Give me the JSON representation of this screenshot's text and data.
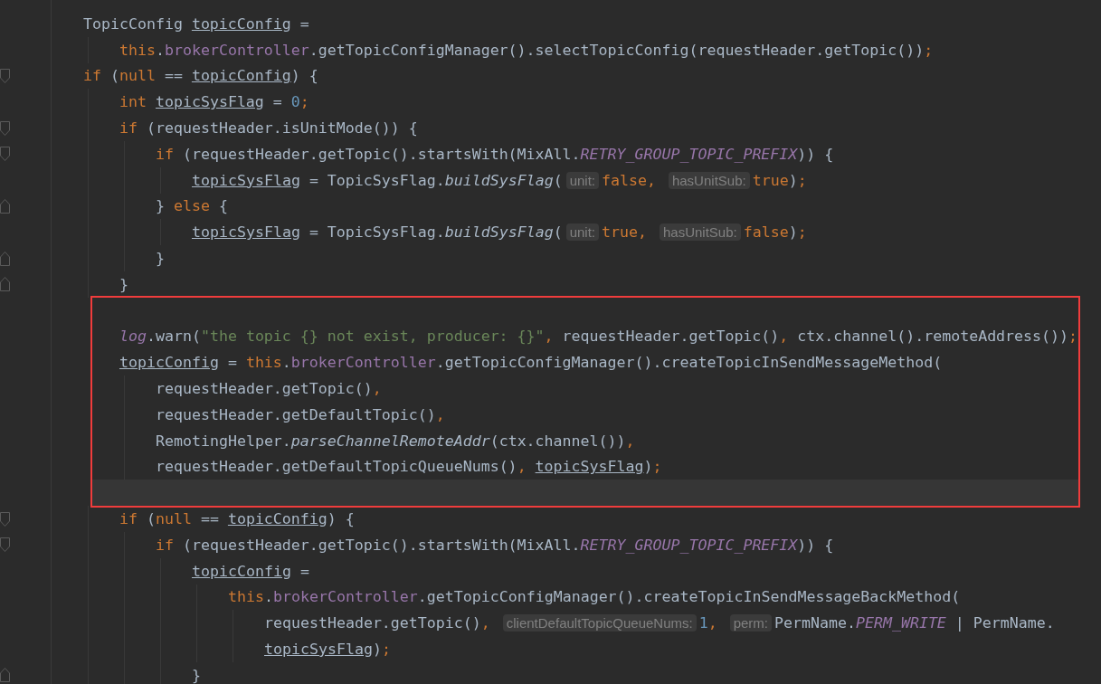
{
  "lines": [
    {
      "tokens": [
        {
          "kind": "plain",
          "text": "TopicConfig "
        },
        {
          "kind": "local",
          "text": "topicConfig"
        },
        {
          "kind": "plain",
          "text": " ="
        }
      ],
      "children": [
        {
          "tokens": [
            {
              "kind": "keyword",
              "text": "this"
            },
            {
              "kind": "plain",
              "text": "."
            },
            {
              "kind": "field",
              "text": "brokerController"
            },
            {
              "kind": "plain",
              "text": ".getTopicConfigManager().selectTopicConfig(requestHeader.getTopic())"
            },
            {
              "kind": "keyword",
              "text": ";"
            }
          ]
        }
      ]
    },
    {
      "fold_start": true,
      "tokens": [
        {
          "kind": "keyword",
          "text": "if"
        },
        {
          "kind": "plain",
          "text": " ("
        },
        {
          "kind": "keyword",
          "text": "null"
        },
        {
          "kind": "plain",
          "text": " == "
        },
        {
          "kind": "local",
          "text": "topicConfig"
        },
        {
          "kind": "plain",
          "text": ") {"
        }
      ],
      "children": [
        {
          "kind": "line",
          "tokens": [
            {
              "kind": "keyword",
              "text": "int "
            },
            {
              "kind": "local",
              "text": "topicSysFlag"
            },
            {
              "kind": "plain",
              "text": " = "
            },
            {
              "kind": "number",
              "text": "0"
            },
            {
              "kind": "keyword",
              "text": ";"
            }
          ]
        },
        {
          "kind": "line",
          "fold_start": true,
          "tokens": [
            {
              "kind": "keyword",
              "text": "if"
            },
            {
              "kind": "plain",
              "text": " (requestHeader.isUnitMode()) {"
            }
          ],
          "children": [
            {
              "fold_start": true,
              "tokens": [
                {
                  "kind": "keyword",
                  "text": "if"
                },
                {
                  "kind": "plain",
                  "text": " (requestHeader.getTopic().startsWith(MixAll."
                },
                {
                  "kind": "constant",
                  "text": "RETRY_GROUP_TOPIC_PREFIX"
                },
                {
                  "kind": "plain",
                  "text": ")) {"
                }
              ],
              "children": [
                {
                  "tokens": [
                    {
                      "kind": "local",
                      "text": "topicSysFlag"
                    },
                    {
                      "kind": "plain",
                      "text": " = TopicSysFlag."
                    },
                    {
                      "kind": "method",
                      "text": "buildSysFlag"
                    },
                    {
                      "kind": "plain",
                      "text": "("
                    },
                    {
                      "kind": "hint",
                      "text": "unit:"
                    },
                    {
                      "kind": "keyword",
                      "text": "false, "
                    },
                    {
                      "kind": "hint",
                      "text": "hasUnitSub:"
                    },
                    {
                      "kind": "keyword",
                      "text": "true"
                    },
                    {
                      "kind": "plain",
                      "text": ")"
                    },
                    {
                      "kind": "keyword",
                      "text": ";"
                    }
                  ]
                }
              ]
            },
            {
              "fold_end": true,
              "tokens": [
                {
                  "kind": "plain",
                  "text": "} "
                },
                {
                  "kind": "keyword",
                  "text": "else"
                },
                {
                  "kind": "plain",
                  "text": " {"
                }
              ],
              "children": [
                {
                  "tokens": [
                    {
                      "kind": "local",
                      "text": "topicSysFlag"
                    },
                    {
                      "kind": "plain",
                      "text": " = TopicSysFlag."
                    },
                    {
                      "kind": "method",
                      "text": "buildSysFlag"
                    },
                    {
                      "kind": "plain",
                      "text": "("
                    },
                    {
                      "kind": "hint",
                      "text": "unit:"
                    },
                    {
                      "kind": "keyword",
                      "text": "true, "
                    },
                    {
                      "kind": "hint",
                      "text": "hasUnitSub:"
                    },
                    {
                      "kind": "keyword",
                      "text": "false"
                    },
                    {
                      "kind": "plain",
                      "text": ")"
                    },
                    {
                      "kind": "keyword",
                      "text": ";"
                    }
                  ]
                }
              ]
            },
            {
              "fold_end": true,
              "tokens": [
                {
                  "kind": "plain",
                  "text": "}"
                }
              ]
            }
          ]
        },
        {
          "kind": "line",
          "fold_end": true,
          "tokens": [
            {
              "kind": "plain",
              "text": "}"
            }
          ]
        },
        {
          "kind": "highlight_box",
          "children": [
            {
              "kind": "line"
            },
            {
              "kind": "line",
              "tokens": [
                {
                  "kind": "static",
                  "text": "log"
                },
                {
                  "kind": "plain",
                  "text": ".warn("
                },
                {
                  "kind": "string",
                  "text": "\"the topic {} not exist, producer: {}\""
                },
                {
                  "kind": "keyword",
                  "text": ","
                },
                {
                  "kind": "plain",
                  "text": " requestHeader.getTopic()"
                },
                {
                  "kind": "keyword",
                  "text": ","
                },
                {
                  "kind": "plain",
                  "text": " ctx.channel().remoteAddress())"
                },
                {
                  "kind": "keyword",
                  "text": ";"
                }
              ]
            },
            {
              "kind": "line",
              "tokens": [
                {
                  "kind": "local",
                  "text": "topicConfig"
                },
                {
                  "kind": "plain",
                  "text": " = "
                },
                {
                  "kind": "keyword",
                  "text": "this"
                },
                {
                  "kind": "plain",
                  "text": "."
                },
                {
                  "kind": "field",
                  "text": "brokerController"
                },
                {
                  "kind": "plain",
                  "text": ".getTopicConfigManager().createTopicInSendMessageMethod("
                }
              ],
              "children": [
                {
                  "tokens": [
                    {
                      "kind": "plain",
                      "text": "requestHeader.getTopic()"
                    },
                    {
                      "kind": "keyword",
                      "text": ","
                    }
                  ]
                },
                {
                  "tokens": [
                    {
                      "kind": "plain",
                      "text": "requestHeader.getDefaultTopic()"
                    },
                    {
                      "kind": "keyword",
                      "text": ","
                    }
                  ]
                },
                {
                  "tokens": [
                    {
                      "kind": "plain",
                      "text": "RemotingHelper."
                    },
                    {
                      "kind": "method",
                      "text": "parseChannelRemoteAddr"
                    },
                    {
                      "kind": "plain",
                      "text": "(ctx.channel())"
                    },
                    {
                      "kind": "keyword",
                      "text": ","
                    }
                  ]
                },
                {
                  "tokens": [
                    {
                      "kind": "plain",
                      "text": "requestHeader.getDefaultTopicQueueNums()"
                    },
                    {
                      "kind": "keyword",
                      "text": ", "
                    },
                    {
                      "kind": "local",
                      "text": "topicSysFlag"
                    },
                    {
                      "kind": "plain",
                      "text": ")"
                    },
                    {
                      "kind": "keyword",
                      "text": ";"
                    }
                  ]
                }
              ]
            },
            {
              "kind": "current_line"
            }
          ]
        },
        {
          "kind": "line",
          "fold_start": true,
          "tokens": [
            {
              "kind": "keyword",
              "text": "if"
            },
            {
              "kind": "plain",
              "text": " ("
            },
            {
              "kind": "keyword",
              "text": "null"
            },
            {
              "kind": "plain",
              "text": " == "
            },
            {
              "kind": "local",
              "text": "topicConfig"
            },
            {
              "kind": "plain",
              "text": ") {"
            }
          ],
          "children": [
            {
              "fold_start": true,
              "tokens": [
                {
                  "kind": "keyword",
                  "text": "if"
                },
                {
                  "kind": "plain",
                  "text": " (requestHeader.getTopic().startsWith(MixAll."
                },
                {
                  "kind": "constant",
                  "text": "RETRY_GROUP_TOPIC_PREFIX"
                },
                {
                  "kind": "plain",
                  "text": ")) {"
                }
              ],
              "children": [
                {
                  "tokens": [
                    {
                      "kind": "local",
                      "text": "topicConfig"
                    },
                    {
                      "kind": "plain",
                      "text": " ="
                    }
                  ],
                  "children": [
                    {
                      "tokens": [
                        {
                          "kind": "keyword",
                          "text": "this"
                        },
                        {
                          "kind": "plain",
                          "text": "."
                        },
                        {
                          "kind": "field",
                          "text": "brokerController"
                        },
                        {
                          "kind": "plain",
                          "text": ".getTopicConfigManager().createTopicInSendMessageBackMethod("
                        }
                      ],
                      "children": [
                        {
                          "tokens": [
                            {
                              "kind": "plain",
                              "text": "requestHeader.getTopic()"
                            },
                            {
                              "kind": "keyword",
                              "text": ", "
                            },
                            {
                              "kind": "hint",
                              "text": "clientDefaultTopicQueueNums:"
                            },
                            {
                              "kind": "number",
                              "text": "1"
                            },
                            {
                              "kind": "keyword",
                              "text": ", "
                            },
                            {
                              "kind": "hint",
                              "text": "perm:"
                            },
                            {
                              "kind": "plain",
                              "text": "PermName."
                            },
                            {
                              "kind": "constant",
                              "text": "PERM_WRITE"
                            },
                            {
                              "kind": "plain",
                              "text": " | PermName."
                            }
                          ]
                        },
                        {
                          "tokens": [
                            {
                              "kind": "local",
                              "text": "topicSysFlag"
                            },
                            {
                              "kind": "plain",
                              "text": ")"
                            },
                            {
                              "kind": "keyword",
                              "text": ";"
                            }
                          ]
                        }
                      ]
                    }
                  ]
                },
                {
                  "fold_end": true,
                  "tokens": [
                    {
                      "kind": "plain",
                      "text": "}"
                    }
                  ]
                }
              ]
            }
          ]
        }
      ]
    }
  ]
}
